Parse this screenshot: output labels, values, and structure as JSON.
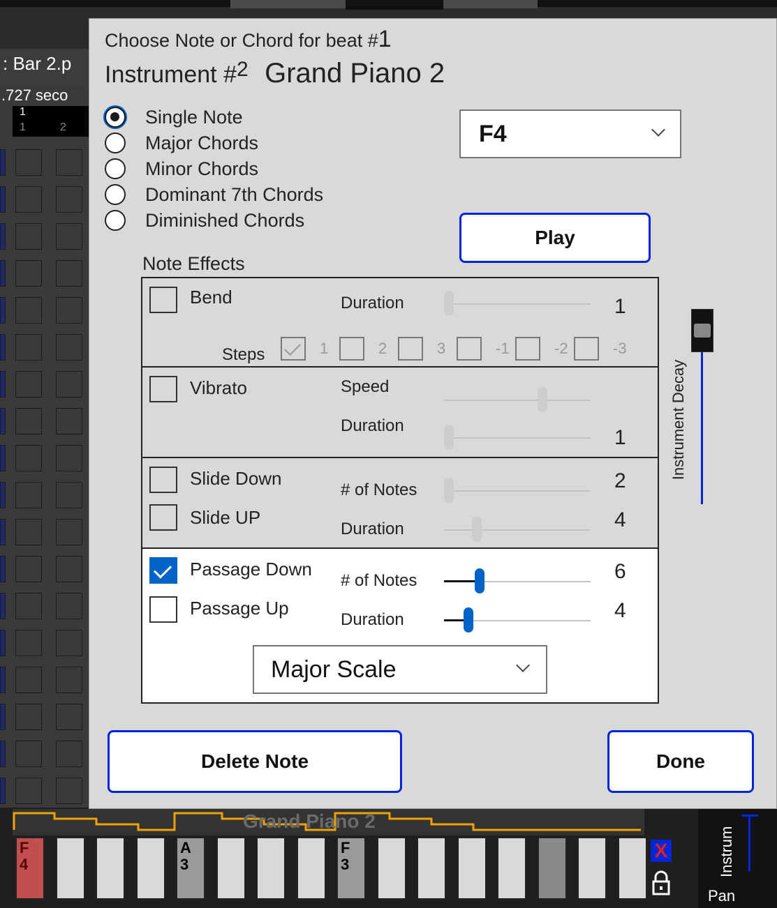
{
  "background": {
    "window_title_fragment": ": Bar 2.p",
    "seconds_fragment": ".727 seco",
    "beat_number_top": "1",
    "beat_numbers": [
      "1",
      "2"
    ],
    "track_name": "Grand Piano 2",
    "keys": [
      {
        "label": "F\n4",
        "active": true
      },
      {
        "label": ""
      },
      {
        "label": ""
      },
      {
        "label": ""
      },
      {
        "label": "A\n3"
      },
      {
        "label": ""
      },
      {
        "label": ""
      },
      {
        "label": ""
      },
      {
        "label": "F\n3"
      },
      {
        "label": ""
      },
      {
        "label": ""
      },
      {
        "label": ""
      },
      {
        "label": ""
      },
      {
        "label": ""
      },
      {
        "label": ""
      },
      {
        "label": ""
      }
    ],
    "right_labels": {
      "instrument": "Instrum",
      "pan": "Pan"
    }
  },
  "dialog": {
    "title_prefix": "Choose Note or Chord for beat #",
    "beat_number": "1",
    "instrument_prefix": "Instrument #",
    "instrument_number": "2",
    "instrument_name": "Grand Piano 2",
    "note_modes": [
      {
        "label": "Single Note",
        "selected": true
      },
      {
        "label": "Major Chords",
        "selected": false
      },
      {
        "label": "Minor Chords",
        "selected": false
      },
      {
        "label": "Dominant 7th Chords",
        "selected": false
      },
      {
        "label": "Diminished Chords",
        "selected": false
      }
    ],
    "note_select": {
      "value": "F4"
    },
    "play_label": "Play",
    "note_effects_label": "Note Effects",
    "bend": {
      "label": "Bend",
      "checked": false,
      "duration_label": "Duration",
      "duration_value": "1",
      "steps_label": "Steps",
      "steps": [
        {
          "label": "1",
          "checked": true
        },
        {
          "label": "2",
          "checked": false
        },
        {
          "label": "3",
          "checked": false
        },
        {
          "label": "-1",
          "checked": false
        },
        {
          "label": "-2",
          "checked": false
        },
        {
          "label": "-3",
          "checked": false
        }
      ]
    },
    "vibrato": {
      "label": "Vibrato",
      "checked": false,
      "speed_label": "Speed",
      "duration_label": "Duration",
      "duration_value": "1"
    },
    "slide": {
      "down_label": "Slide Down",
      "down_checked": false,
      "up_label": "Slide UP",
      "up_checked": false,
      "notes_label": "# of Notes",
      "notes_value": "2",
      "duration_label": "Duration",
      "duration_value": "4"
    },
    "passage": {
      "down_label": "Passage Down",
      "down_checked": true,
      "up_label": "Passage Up",
      "up_checked": false,
      "notes_label": "# of Notes",
      "notes_value": "6",
      "duration_label": "Duration",
      "duration_value": "4",
      "scale_value": "Major Scale"
    },
    "instrument_decay_label": "Instrument Decay",
    "delete_label": "Delete Note",
    "done_label": "Done"
  },
  "colors": {
    "accent": "#0063c7",
    "button_border": "#0026d9",
    "highlight_key": "#c0504d",
    "track_line": "#f0a000"
  }
}
